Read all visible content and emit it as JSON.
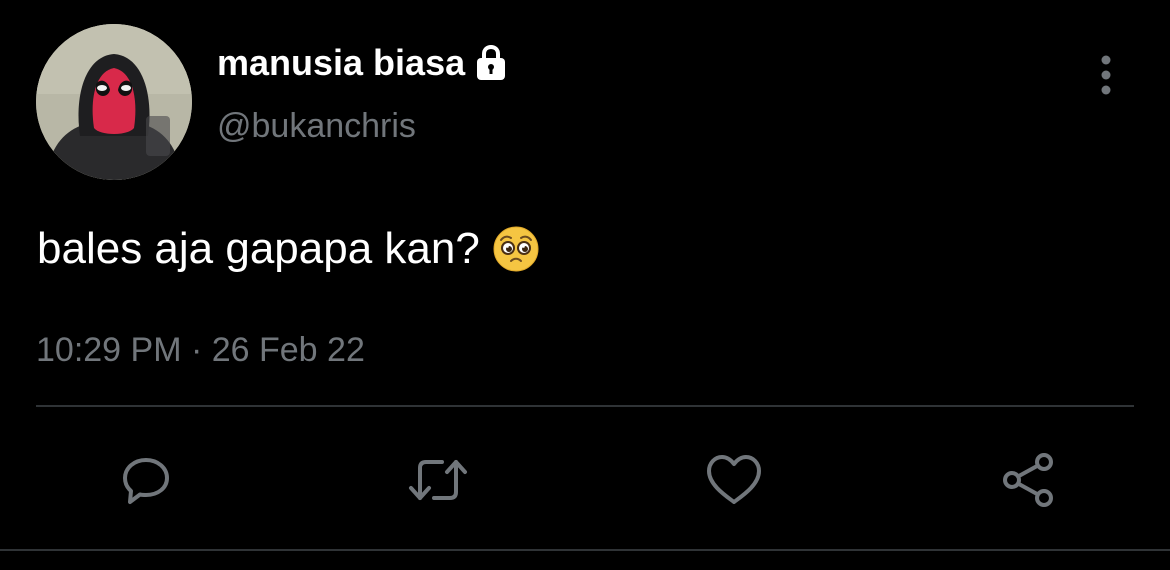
{
  "author": {
    "display_name": "manusia biasa",
    "handle": "@bukanchris",
    "protected": true
  },
  "tweet": {
    "text": "bales aja gapapa kan?",
    "emoji": "pleading-face",
    "timestamp": "10:29 PM · 26 Feb 22"
  },
  "actions": [
    "reply",
    "retweet",
    "like",
    "share"
  ],
  "colors": {
    "background": "#000000",
    "primary_text": "#ffffff",
    "secondary_text": "#71767b",
    "icon": "#71767b",
    "divider": "#2f3336"
  }
}
